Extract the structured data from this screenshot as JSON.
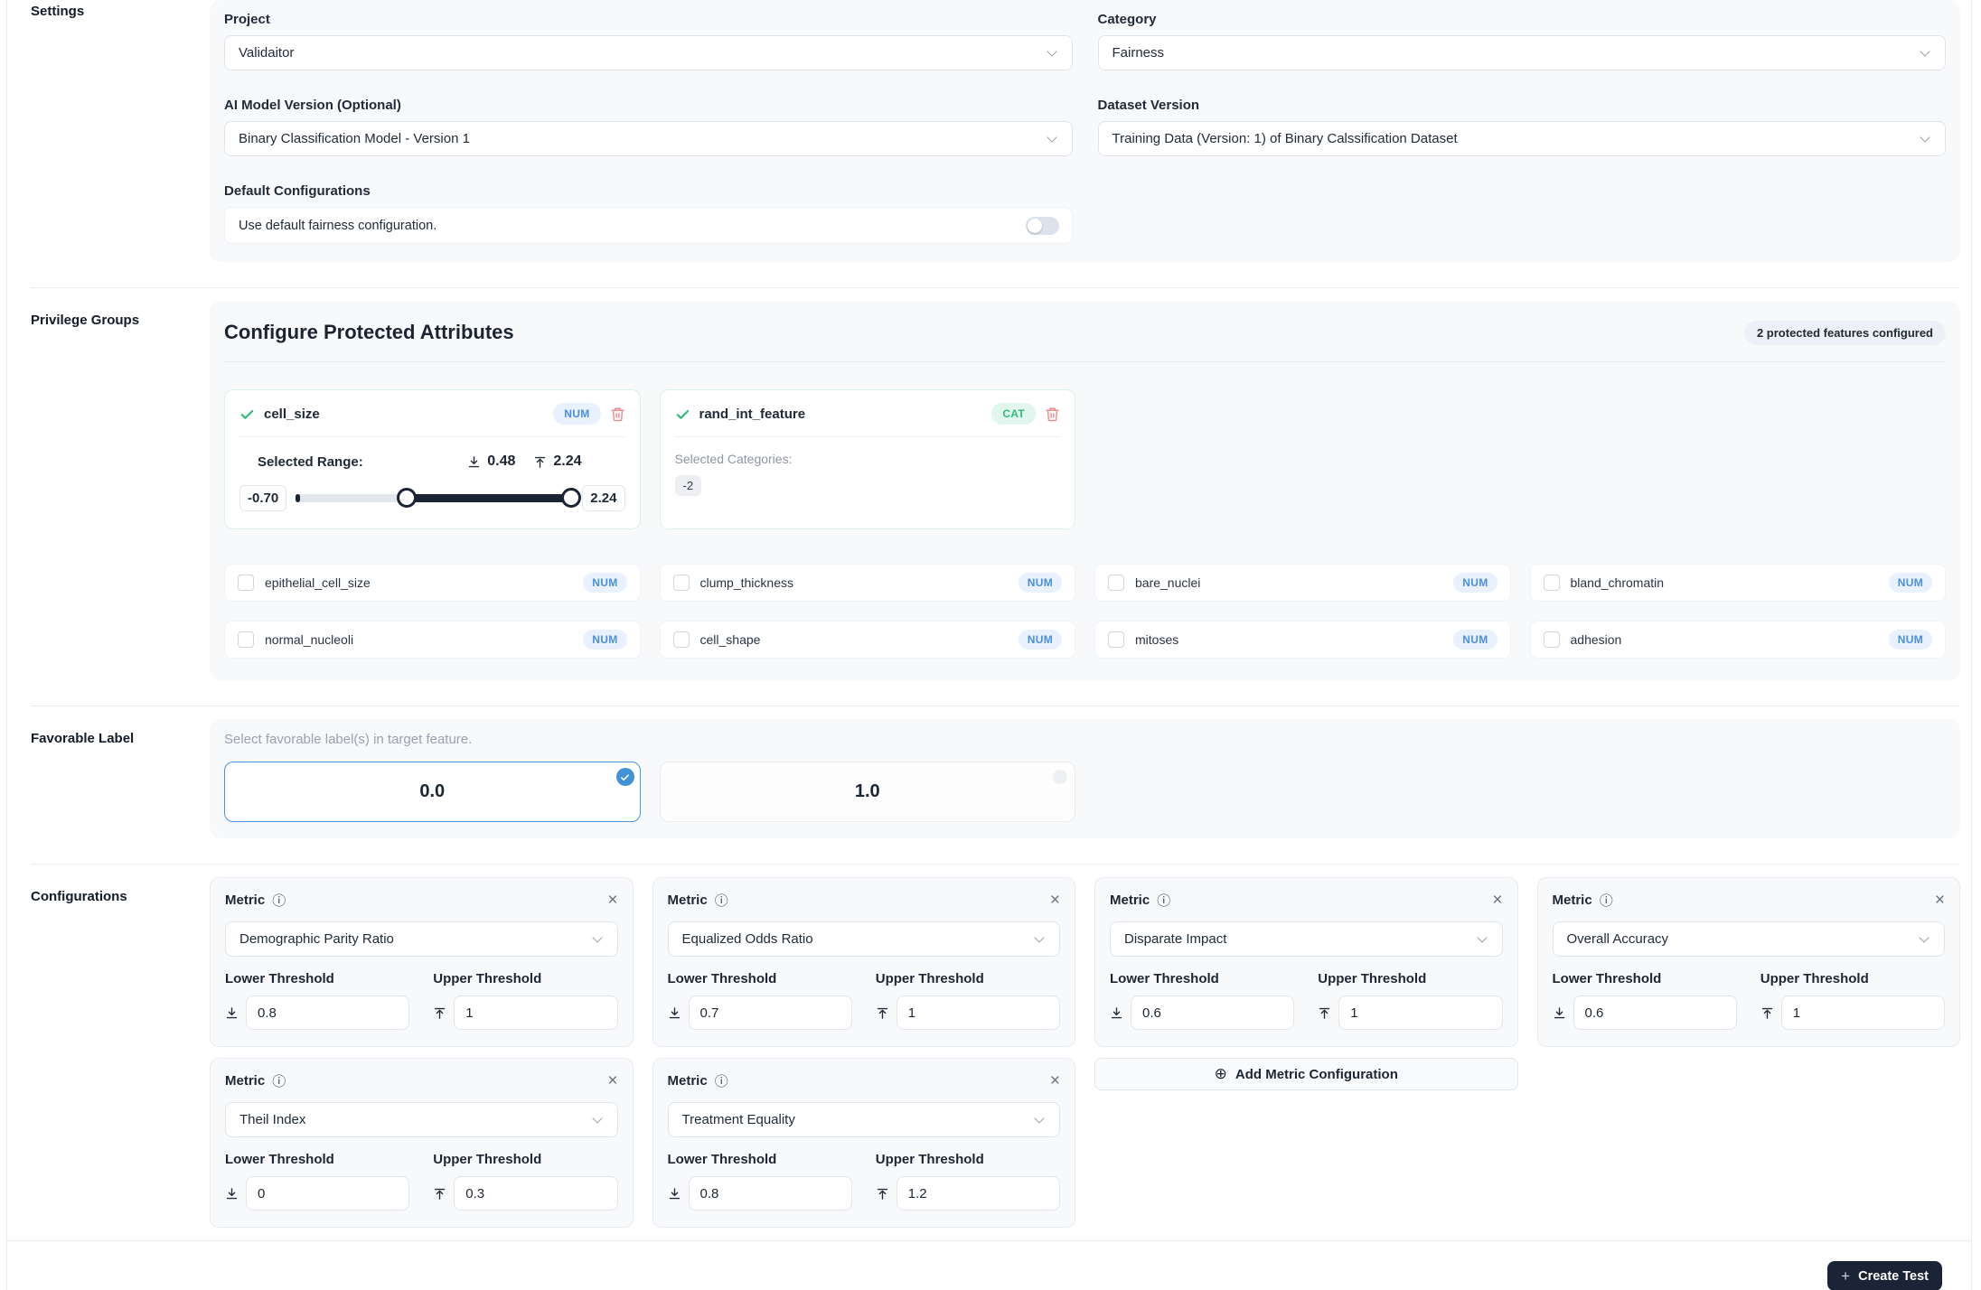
{
  "icons": {
    "info": "ⓘ",
    "close": "×",
    "add_circle": "⊕",
    "plus": "+"
  },
  "sections": {
    "settings": {
      "label": "Settings",
      "project_label": "Project",
      "project_value": "Validaitor",
      "category_label": "Category",
      "category_value": "Fairness",
      "model_label": "AI Model Version (Optional)",
      "model_value": "Binary Classification Model - Version 1",
      "dataset_label": "Dataset Version",
      "dataset_value": "Training Data (Version: 1) of Binary Calssification Dataset",
      "default_config_label": "Default Configurations",
      "default_config_text": "Use default fairness configuration.",
      "default_config_toggle_state": "off"
    },
    "privilege": {
      "label": "Privilege Groups",
      "heading": "Configure Protected Attributes",
      "configured_badge": "2 protected features configured",
      "selected_numeric": {
        "name": "cell_size",
        "type_badge": "NUM",
        "range_label": "Selected Range:",
        "range_low": "0.48",
        "range_high": "2.24",
        "slider_min": "-0.70",
        "slider_max": "2.24",
        "slider_fill_start_pct": 40
      },
      "selected_categorical": {
        "name": "rand_int_feature",
        "type_badge": "CAT",
        "categories_label": "Selected Categories:",
        "categories": {
          "0": "-2"
        }
      },
      "features": [
        {
          "name": "epithelial_cell_size",
          "type": "NUM",
          "checked": false
        },
        {
          "name": "clump_thickness",
          "type": "NUM",
          "checked": false
        },
        {
          "name": "bare_nuclei",
          "type": "NUM",
          "checked": false
        },
        {
          "name": "bland_chromatin",
          "type": "NUM",
          "checked": false
        },
        {
          "name": "normal_nucleoli",
          "type": "NUM",
          "checked": false
        },
        {
          "name": "cell_shape",
          "type": "NUM",
          "checked": false
        },
        {
          "name": "mitoses",
          "type": "NUM",
          "checked": false
        },
        {
          "name": "adhesion",
          "type": "NUM",
          "checked": false
        }
      ]
    },
    "favorable": {
      "label": "Favorable Label",
      "hint": "Select favorable label(s) in target feature.",
      "options": [
        {
          "value": "0.0",
          "selected": true
        },
        {
          "value": "1.0",
          "selected": false
        }
      ]
    },
    "configurations": {
      "label": "Configurations",
      "metric_label": "Metric",
      "lower_label": "Lower Threshold",
      "upper_label": "Upper Threshold",
      "add_button_label": "Add Metric Configuration",
      "metrics": [
        {
          "name": "Demographic Parity Ratio",
          "lower": "0.8",
          "upper": "1"
        },
        {
          "name": "Equalized Odds Ratio",
          "lower": "0.7",
          "upper": "1"
        },
        {
          "name": "Disparate Impact",
          "lower": "0.6",
          "upper": "1"
        },
        {
          "name": "Overall Accuracy",
          "lower": "0.6",
          "upper": "1"
        },
        {
          "name": "Theil Index",
          "lower": "0",
          "upper": "0.3"
        },
        {
          "name": "Treatment Equality",
          "lower": "0.8",
          "upper": "1.2"
        }
      ]
    }
  },
  "footer": {
    "create_test_label": "Create Test"
  },
  "colors": {
    "accent_blue": "#4b8fe2",
    "accent_green": "#2fbf7e",
    "danger": "#ee8b8b",
    "dark_navy": "#1b2437",
    "panel_bg": "#f8f9fb",
    "selected_border": "#4e94d6"
  }
}
